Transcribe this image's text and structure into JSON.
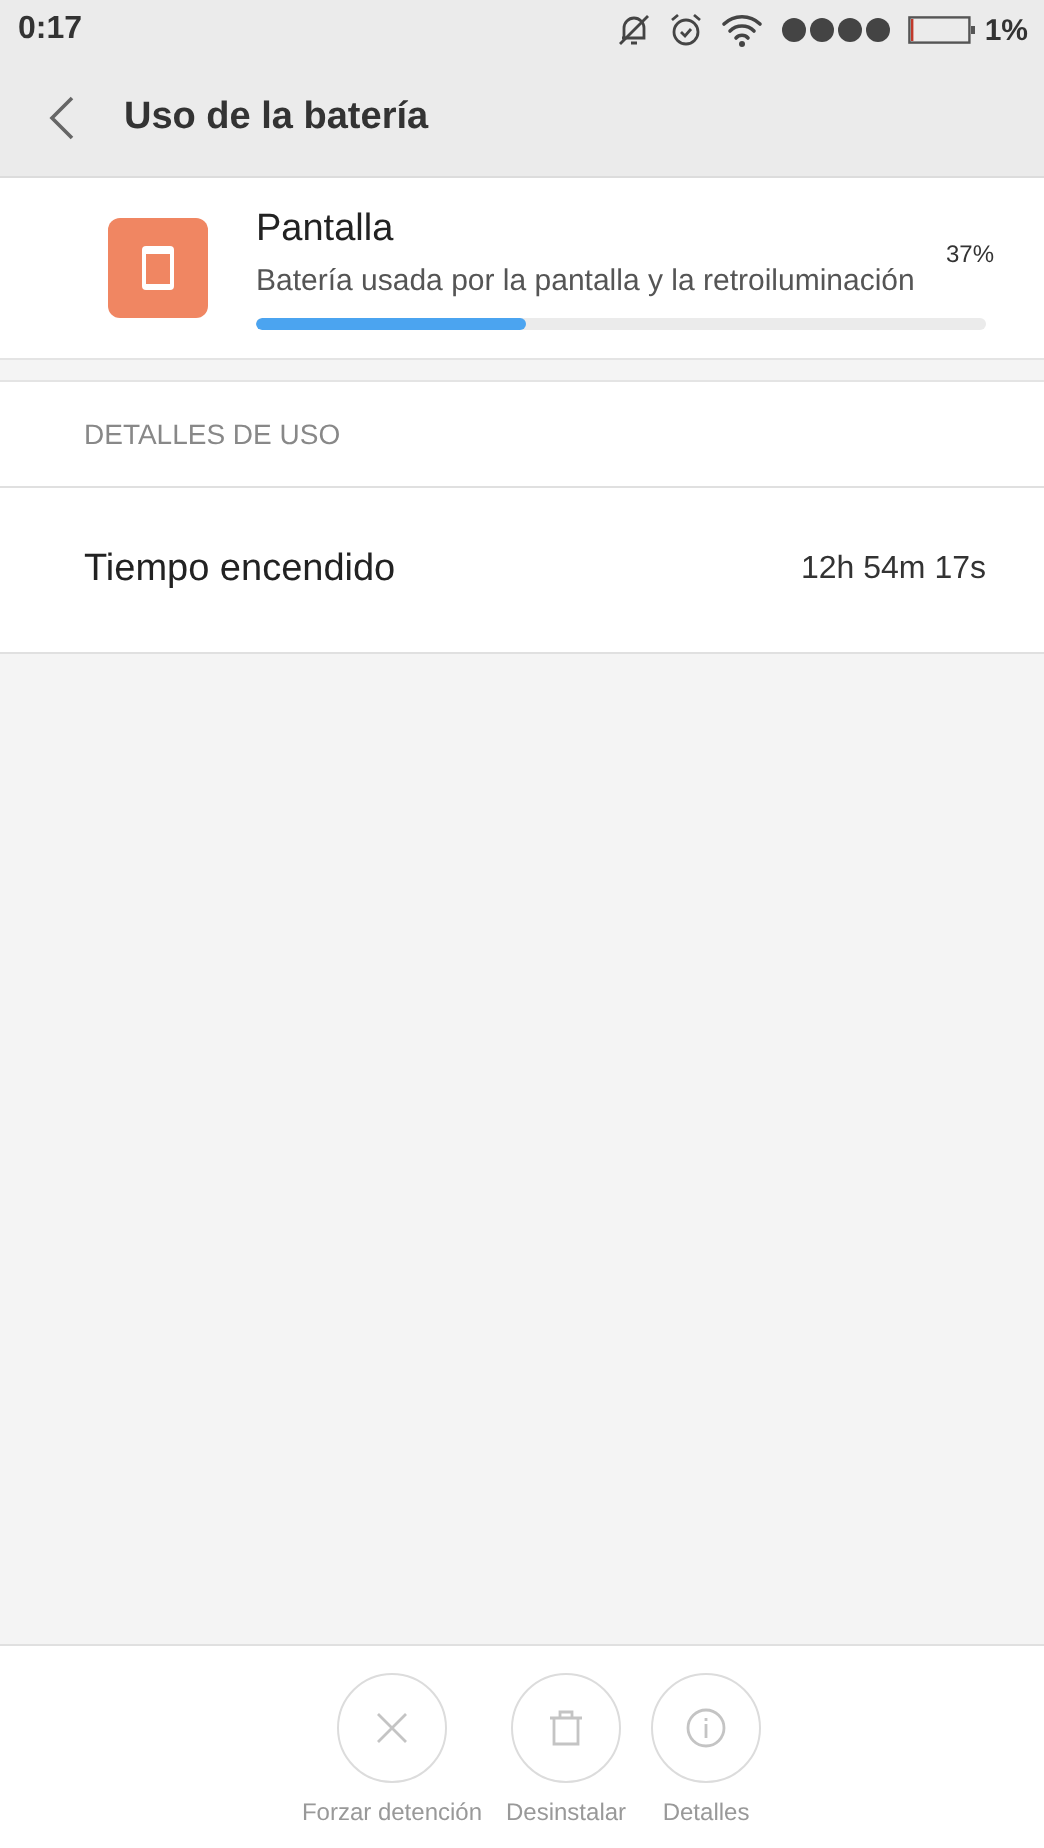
{
  "status_bar": {
    "time": "0:17",
    "battery": "1%"
  },
  "header": {
    "title": "Uso de la batería"
  },
  "usage_item": {
    "name": "Pantalla",
    "description": "Batería usada por la pantalla y la retroiluminación",
    "percent": "37%",
    "level": 0.37
  },
  "details": {
    "heading": "DETALLES DE USO",
    "rows": [
      {
        "label": "Tiempo encendido",
        "value": "12h 54m 17s"
      }
    ]
  },
  "actions": [
    {
      "kind": "stop",
      "label": "Forzar detención",
      "disabled": true
    },
    {
      "kind": "uninstall",
      "label": "Desinstalar",
      "disabled": true
    },
    {
      "kind": "info",
      "label": "Detalles",
      "disabled": true
    }
  ]
}
